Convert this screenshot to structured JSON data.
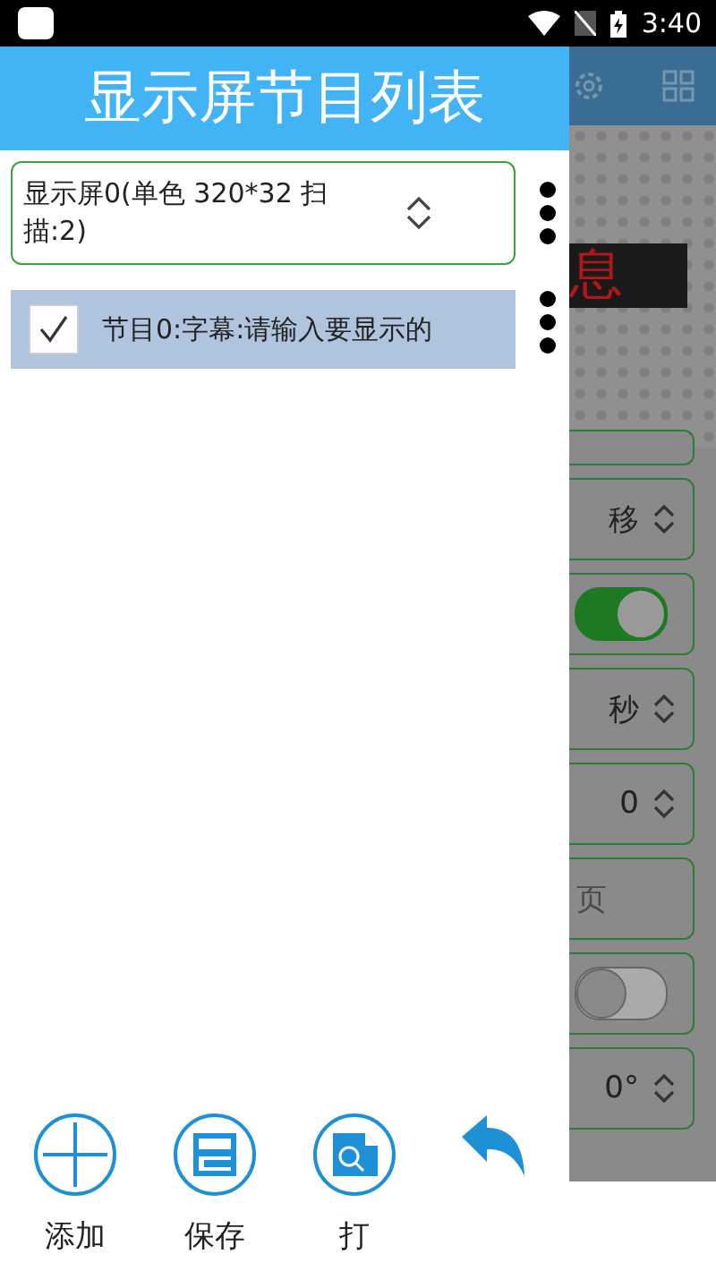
{
  "status_bar": {
    "time": "3:40"
  },
  "background_app": {
    "led_text": "息",
    "fields": [
      {
        "kind": "select",
        "value": "移"
      },
      {
        "kind": "toggle",
        "on": true
      },
      {
        "kind": "select",
        "value": "秒"
      },
      {
        "kind": "select",
        "value": "0"
      },
      {
        "kind": "text",
        "placeholder": "页"
      },
      {
        "kind": "toggle",
        "on": false
      },
      {
        "kind": "select",
        "value": "0°"
      }
    ]
  },
  "drawer": {
    "title": "显示屏节目列表",
    "screen_select": {
      "value": "显示屏0(单色 320*32 扫描:2)"
    },
    "programs": [
      {
        "label": "节目0:字幕:请输入要显示的",
        "checked": true
      }
    ],
    "buttons": [
      {
        "kind": "add",
        "label": "添加"
      },
      {
        "kind": "save",
        "label": "保存"
      },
      {
        "kind": "print",
        "label": "打"
      },
      {
        "kind": "undo"
      }
    ]
  }
}
